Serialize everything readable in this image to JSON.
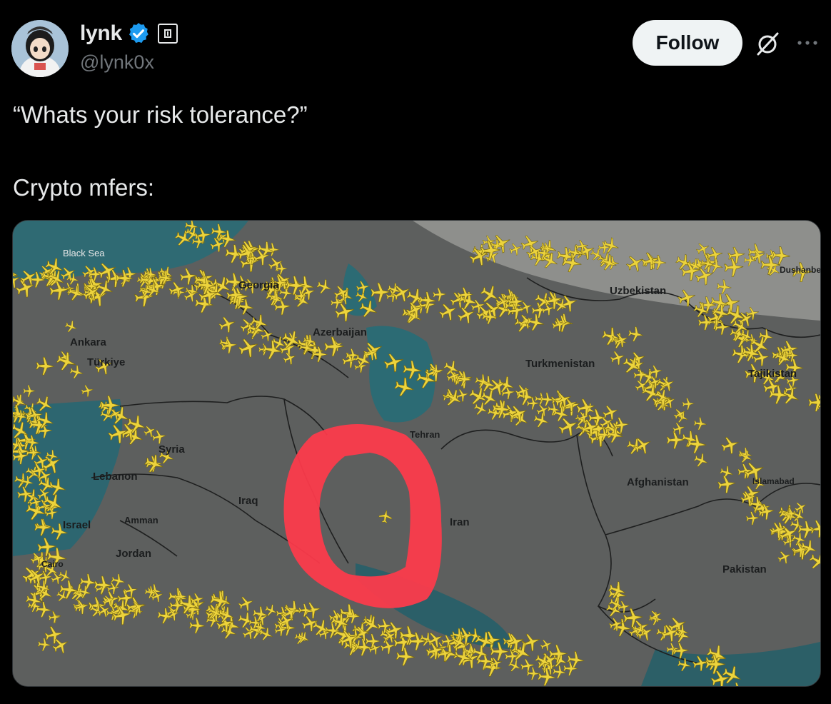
{
  "author": {
    "display_name": "lynk",
    "handle": "@lynk0x",
    "avatar_icon": "anime-avatar"
  },
  "follow_label": "Follow",
  "tweet": {
    "line1": "“Whats your risk tolerance?”",
    "line2": "Crypto mfers:"
  },
  "map": {
    "labels": {
      "black_sea": "Black Sea",
      "georgia": "Georgia",
      "azerbaijan": "Azerbaijan",
      "ankara": "Ankara",
      "turkiye": "Türkiye",
      "uzbekistan": "Uzbekistan",
      "turkmenistan": "Turkmenistan",
      "tajikistan": "Tajikistan",
      "tehran": "Tehran",
      "syria": "Syria",
      "lebanon": "Lebanon",
      "iraq": "Iraq",
      "iran": "Iran",
      "afghanistan": "Afghanistan",
      "islamabad": "Islamabad",
      "israel": "Israel",
      "amman": "Amman",
      "jordan": "Jordan",
      "cairo": "Cairo",
      "pakistan": "Pakistan",
      "dushanbe": "Dushanbe"
    },
    "colors": {
      "land": "#5d5f5e",
      "water": "#2f6a73",
      "planes": "#e9d23a",
      "circle": "#ff3344"
    }
  }
}
